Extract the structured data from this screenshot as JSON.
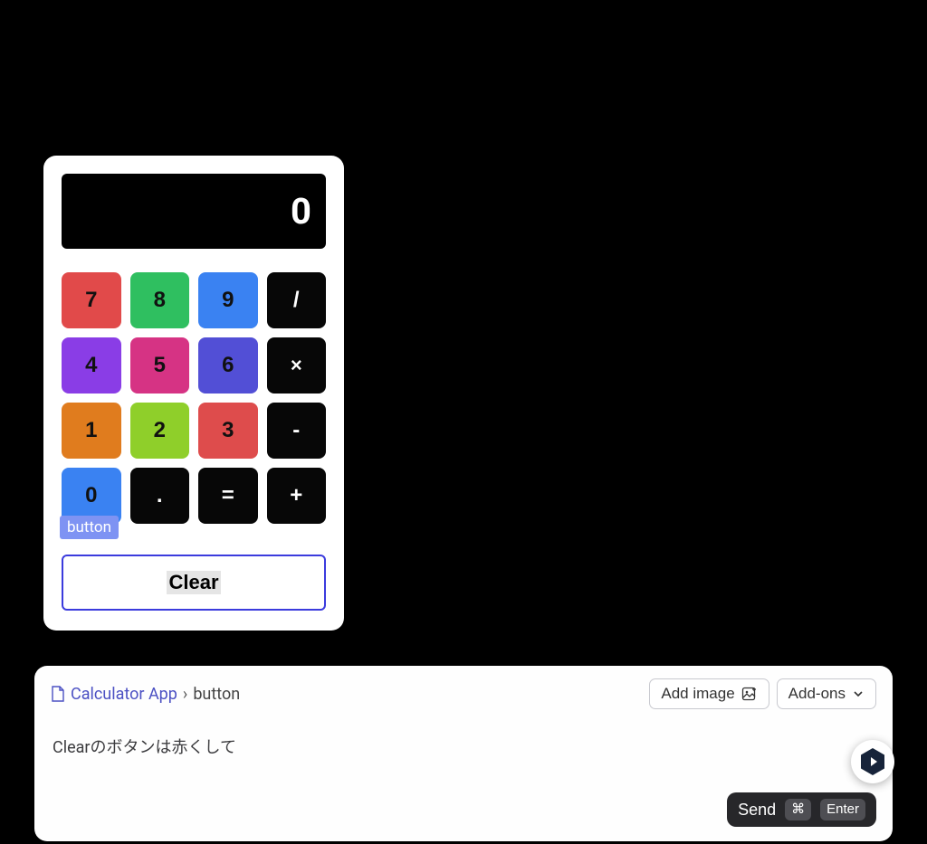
{
  "calculator": {
    "display_value": "0",
    "keys": [
      {
        "label": "7",
        "class": "k7",
        "interactable": true
      },
      {
        "label": "8",
        "class": "k8",
        "interactable": true
      },
      {
        "label": "9",
        "class": "k9",
        "interactable": true
      },
      {
        "label": "/",
        "class": "kop",
        "interactable": true
      },
      {
        "label": "4",
        "class": "k4",
        "interactable": true
      },
      {
        "label": "5",
        "class": "k5",
        "interactable": true
      },
      {
        "label": "6",
        "class": "k6",
        "interactable": true
      },
      {
        "label": "×",
        "class": "kop op-times",
        "interactable": true
      },
      {
        "label": "1",
        "class": "k1",
        "interactable": true
      },
      {
        "label": "2",
        "class": "k2",
        "interactable": true
      },
      {
        "label": "3",
        "class": "k3",
        "interactable": true
      },
      {
        "label": "-",
        "class": "kop",
        "interactable": true
      },
      {
        "label": "0",
        "class": "k0",
        "interactable": true
      },
      {
        "label": ".",
        "class": "kop",
        "interactable": true
      },
      {
        "label": "=",
        "class": "kop",
        "interactable": true
      },
      {
        "label": "+",
        "class": "kop",
        "interactable": true
      }
    ],
    "tooltip_label": "button",
    "clear_label": "Clear"
  },
  "prompt": {
    "breadcrumb": {
      "first": "Calculator App",
      "second": "button"
    },
    "add_image_label": "Add image",
    "addons_label": "Add-ons",
    "input_text": "Clearのボタンは赤くして",
    "send_label": "Send",
    "shortcut_cmd": "⌘",
    "shortcut_key": "Enter"
  }
}
